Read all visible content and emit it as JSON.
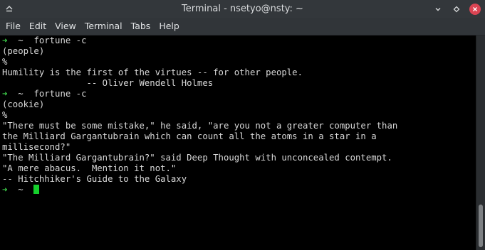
{
  "window": {
    "title": "Terminal - nsetyo@nsty: ~"
  },
  "menu": [
    "File",
    "Edit",
    "View",
    "Terminal",
    "Tabs",
    "Help"
  ],
  "terminal": {
    "prompt_arrow": "➜",
    "prompt_dir": "~",
    "lines": [
      {
        "type": "prompt",
        "command": "fortune -c"
      },
      {
        "type": "output",
        "text": "(people)"
      },
      {
        "type": "output",
        "text": "%"
      },
      {
        "type": "output",
        "text": "Humility is the first of the virtues -- for other people."
      },
      {
        "type": "output",
        "text": "                -- Oliver Wendell Holmes"
      },
      {
        "type": "prompt",
        "command": "fortune -c"
      },
      {
        "type": "output",
        "text": "(cookie)"
      },
      {
        "type": "output",
        "text": "%"
      },
      {
        "type": "output",
        "text": "\"There must be some mistake,\" he said, \"are you not a greater computer than"
      },
      {
        "type": "output",
        "text": "the Milliard Gargantubrain which can count all the atoms in a star in a"
      },
      {
        "type": "output",
        "text": "millisecond?\""
      },
      {
        "type": "output",
        "text": "\"The Milliard Gargantubrain?\" said Deep Thought with unconcealed contempt."
      },
      {
        "type": "output",
        "text": "\"A mere abacus.  Mention it not.\""
      },
      {
        "type": "output",
        "text": "-- Hitchhiker's Guide to the Galaxy"
      },
      {
        "type": "prompt",
        "command": "",
        "cursor": true
      }
    ]
  },
  "colors": {
    "prompt_arrow": "#3fd14b",
    "cursor": "#15d02c",
    "close_button": "#da4453"
  }
}
